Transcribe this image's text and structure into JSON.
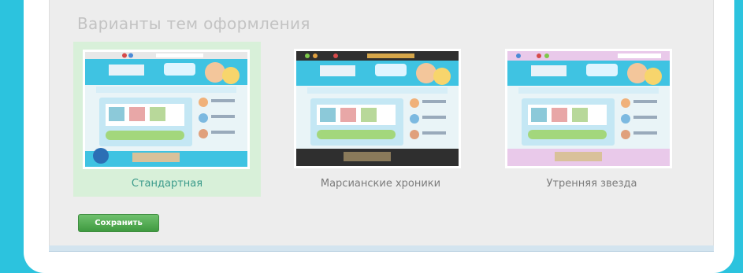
{
  "section": {
    "title": "Варианты тем оформления"
  },
  "themes": [
    {
      "label": "Стандартная",
      "selected": true,
      "toolbar_color": "#e8e8e8",
      "accent": "#b5e3f5"
    },
    {
      "label": "Марсианские хроники",
      "selected": false,
      "toolbar_color": "#2f2f2f",
      "accent": "#7fd0ea"
    },
    {
      "label": "Утренняя звезда",
      "selected": false,
      "toolbar_color": "#e9c9ea",
      "accent": "#b5e3f5"
    }
  ],
  "actions": {
    "save_label": "Сохранить"
  },
  "colors": {
    "page_background": "#2cc3de",
    "selected_background": "#d8f0d9",
    "button_green": "#4aa84a"
  }
}
